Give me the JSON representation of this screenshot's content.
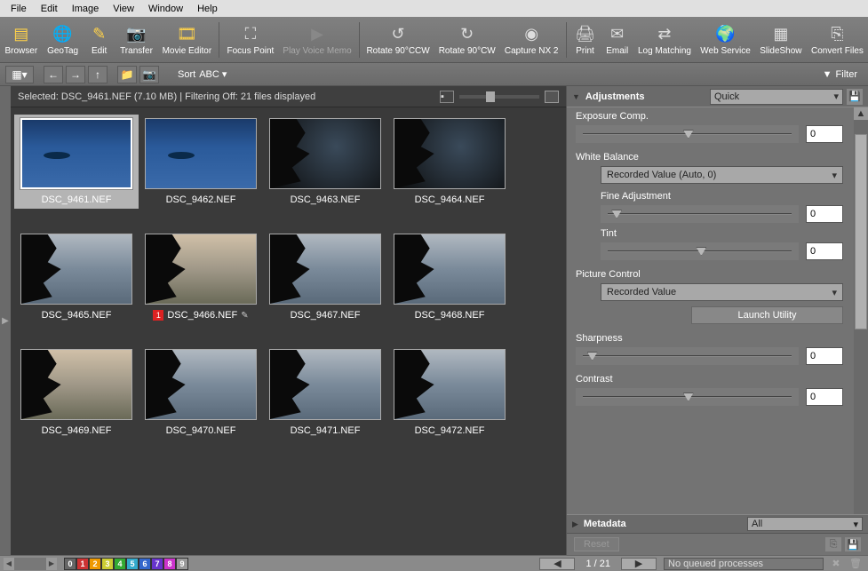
{
  "menu": {
    "file": "File",
    "edit": "Edit",
    "image": "Image",
    "view": "View",
    "window": "Window",
    "help": "Help"
  },
  "tools": {
    "browser": "Browser",
    "geotag": "GeoTag",
    "edit": "Edit",
    "transfer": "Transfer",
    "movie": "Movie Editor",
    "focus": "Focus Point",
    "voice": "Play Voice Memo",
    "rccw": "Rotate 90°CCW",
    "rcw": "Rotate 90°CW",
    "nx2": "Capture NX 2",
    "print": "Print",
    "email": "Email",
    "log": "Log Matching",
    "web": "Web Service",
    "slide": "SlideShow",
    "convert": "Convert Files"
  },
  "sortbar": {
    "sort": "Sort",
    "sortkey": "ABC",
    "filter": "Filter"
  },
  "status": {
    "text": "Selected: DSC_9461.NEF (7.10 MB) | Filtering Off: 21 files displayed"
  },
  "thumbs": [
    {
      "name": "DSC_9461.NEF",
      "cls": "img-blue-fog",
      "sel": true,
      "island": true
    },
    {
      "name": "DSC_9462.NEF",
      "cls": "img-blue-fog",
      "island": true
    },
    {
      "name": "DSC_9463.NEF",
      "cls": "img-dark-tree",
      "tree": true
    },
    {
      "name": "DSC_9464.NEF",
      "cls": "img-dark-tree",
      "tree": true
    },
    {
      "name": "DSC_9465.NEF",
      "cls": "img-lake",
      "tree": true
    },
    {
      "name": "DSC_9466.NEF",
      "cls": "img-lake-warm",
      "tree": true,
      "tag": "1",
      "pencil": true
    },
    {
      "name": "DSC_9467.NEF",
      "cls": "img-lake",
      "tree": true
    },
    {
      "name": "DSC_9468.NEF",
      "cls": "img-lake",
      "tree": true
    },
    {
      "name": "DSC_9469.NEF",
      "cls": "img-lake-warm",
      "tree": true
    },
    {
      "name": "DSC_9470.NEF",
      "cls": "img-lake",
      "tree": true
    },
    {
      "name": "DSC_9471.NEF",
      "cls": "img-lake",
      "tree": true
    },
    {
      "name": "DSC_9472.NEF",
      "cls": "img-lake",
      "tree": true
    }
  ],
  "panel": {
    "adjustments": "Adjustments",
    "preset": "Quick",
    "exposure": "Exposure Comp.",
    "exposure_val": "0",
    "wb": "White Balance",
    "wb_preset": "Recorded Value (Auto, 0)",
    "fine": "Fine Adjustment",
    "fine_val": "0",
    "tint": "Tint",
    "tint_val": "0",
    "pc": "Picture Control",
    "pc_preset": "Recorded Value",
    "pc_btn": "Launch Utility",
    "sharp": "Sharpness",
    "sharp_val": "0",
    "contrast": "Contrast",
    "contrast_val": "0",
    "metadata": "Metadata",
    "meta_preset": "All",
    "reset": "Reset"
  },
  "bottom": {
    "labels": [
      "0",
      "1",
      "2",
      "3",
      "4",
      "5",
      "6",
      "7",
      "8",
      "9"
    ],
    "label_colors": [
      "#666",
      "#c33",
      "#e90",
      "#cc3",
      "#3a3",
      "#3ac",
      "#36c",
      "#63c",
      "#c3c",
      "#999"
    ],
    "page": "1 / 21",
    "queue": "No queued processes"
  }
}
